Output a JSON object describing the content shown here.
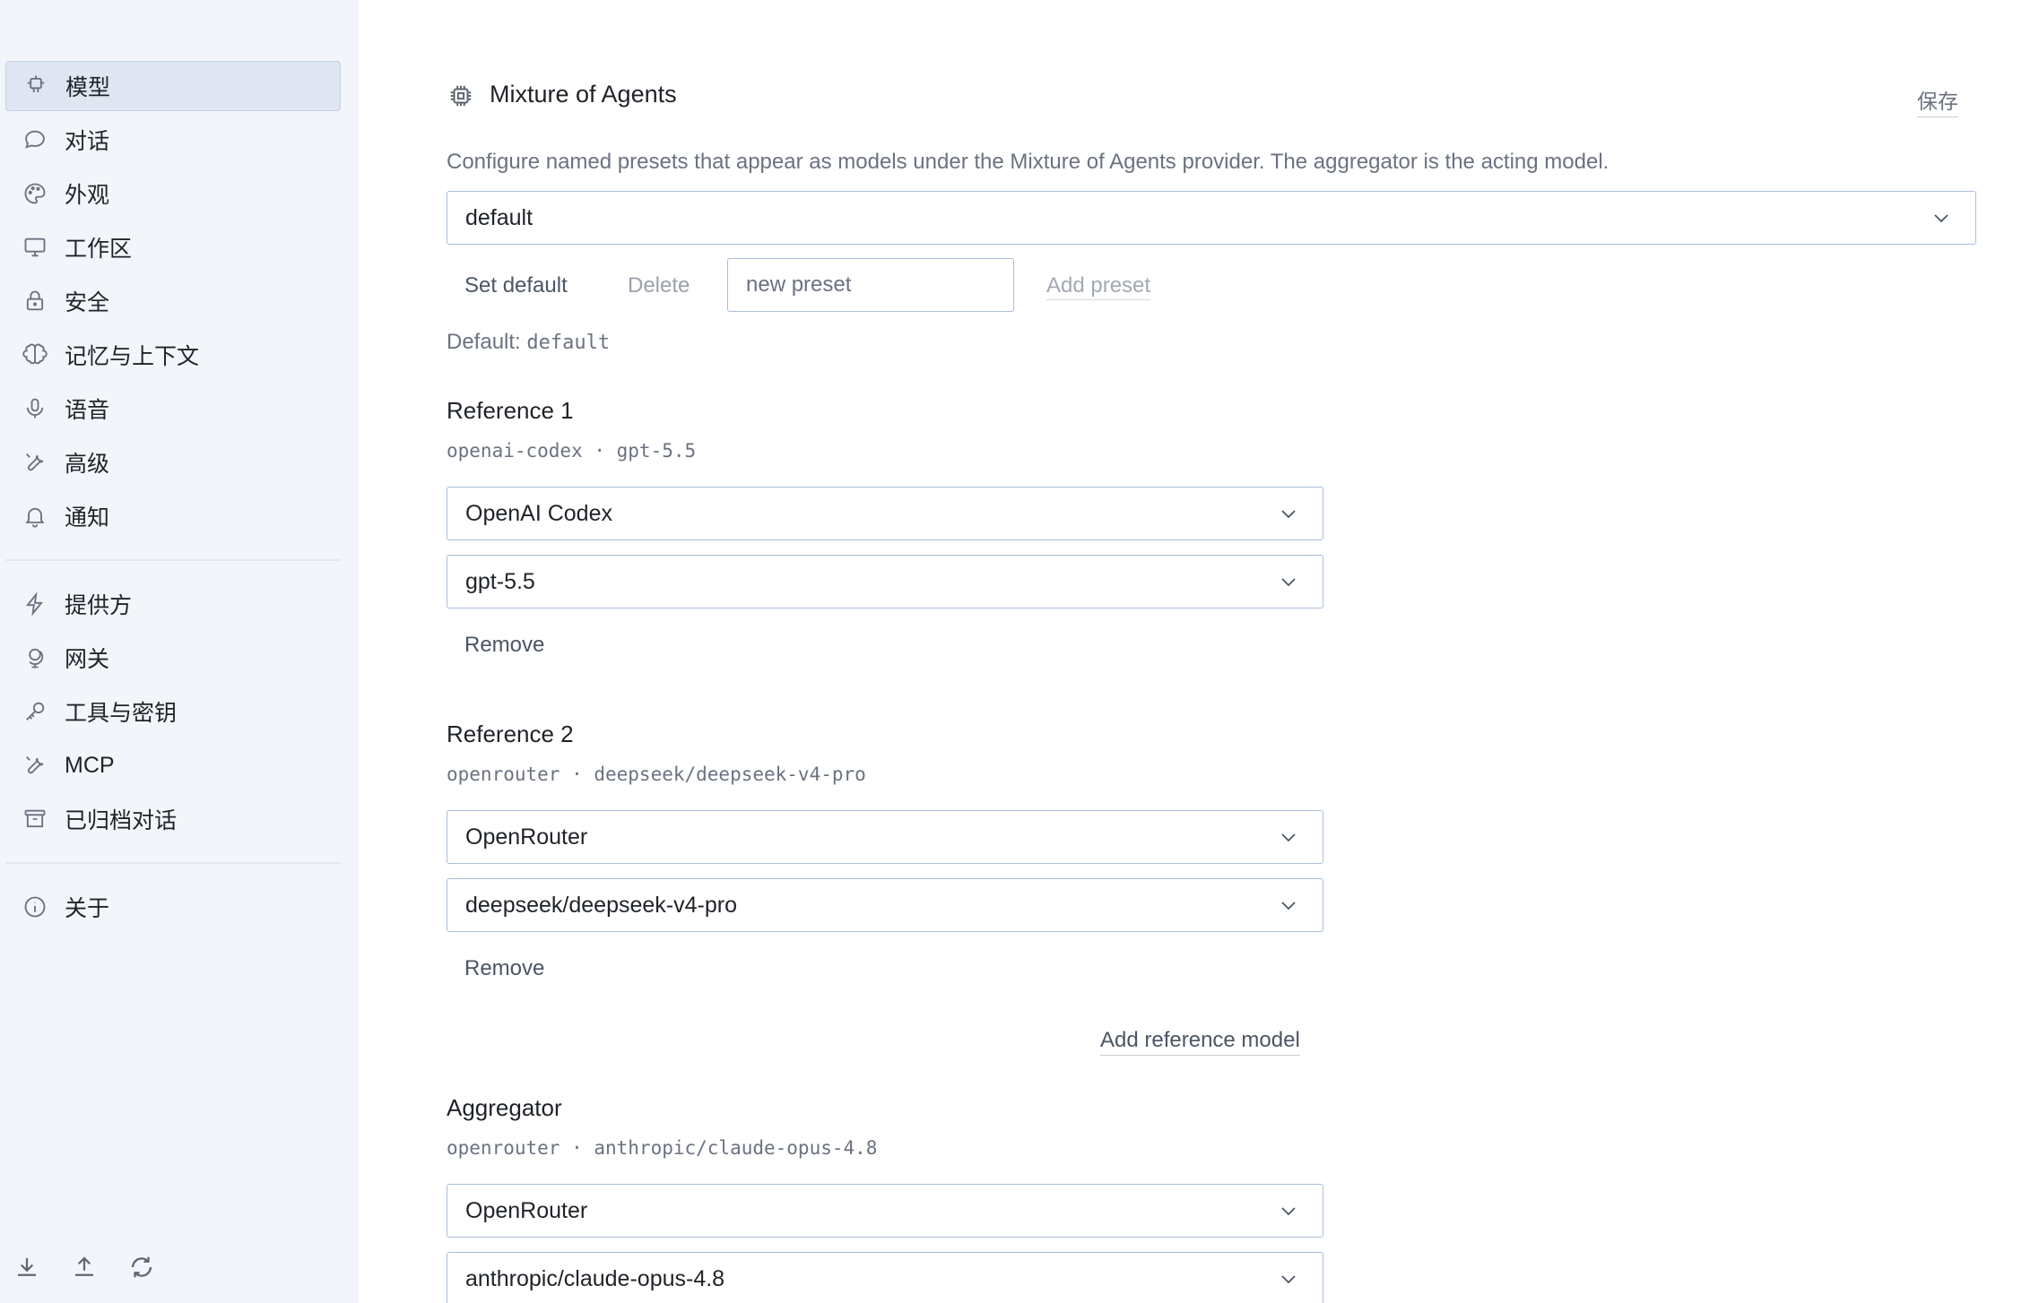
{
  "sidebar": {
    "items": [
      {
        "label": "模型",
        "icon": "cpu-icon",
        "active": true
      },
      {
        "label": "对话",
        "icon": "chat-bubble-icon"
      },
      {
        "label": "外观",
        "icon": "palette-icon"
      },
      {
        "label": "工作区",
        "icon": "monitor-icon"
      },
      {
        "label": "安全",
        "icon": "lock-icon"
      },
      {
        "label": "记忆与上下文",
        "icon": "brain-icon"
      },
      {
        "label": "语音",
        "icon": "microphone-icon"
      },
      {
        "label": "高级",
        "icon": "wrench-icon"
      },
      {
        "label": "通知",
        "icon": "bell-icon"
      }
    ],
    "items2": [
      {
        "label": "提供方",
        "icon": "lightning-icon"
      },
      {
        "label": "网关",
        "icon": "globe-stand-icon"
      },
      {
        "label": "工具与密钥",
        "icon": "key-icon"
      },
      {
        "label": "MCP",
        "icon": "wrench-icon"
      },
      {
        "label": "已归档对话",
        "icon": "archive-icon"
      }
    ],
    "items3": [
      {
        "label": "关于",
        "icon": "info-icon"
      }
    ],
    "bottom_icons": [
      "download-icon",
      "upload-icon",
      "refresh-icon"
    ]
  },
  "header": {
    "title": "Mixture of Agents",
    "icon": "cpu-icon",
    "save_label": "保存"
  },
  "description": "Configure named presets that appear as models under the Mixture of Agents provider. The aggregator is the acting model.",
  "preset": {
    "selected": "default",
    "set_default_label": "Set default",
    "delete_label": "Delete",
    "new_preset_placeholder": "new preset",
    "add_preset_label": "Add preset",
    "default_prefix": "Default:",
    "default_value": "default"
  },
  "references": [
    {
      "title": "Reference 1",
      "summary": "openai-codex · gpt-5.5",
      "provider": "OpenAI Codex",
      "model": "gpt-5.5",
      "remove_label": "Remove"
    },
    {
      "title": "Reference 2",
      "summary": "openrouter · deepseek/deepseek-v4-pro",
      "provider": "OpenRouter",
      "model": "deepseek/deepseek-v4-pro",
      "remove_label": "Remove"
    }
  ],
  "add_reference_label": "Add reference model",
  "aggregator": {
    "title": "Aggregator",
    "summary": "openrouter · anthropic/claude-opus-4.8",
    "provider": "OpenRouter",
    "model": "anthropic/claude-opus-4.8"
  },
  "colors": {
    "sidebar_bg": "#f2f5fa",
    "active_bg": "#dfe6f1",
    "input_border": "#a9bedb"
  }
}
